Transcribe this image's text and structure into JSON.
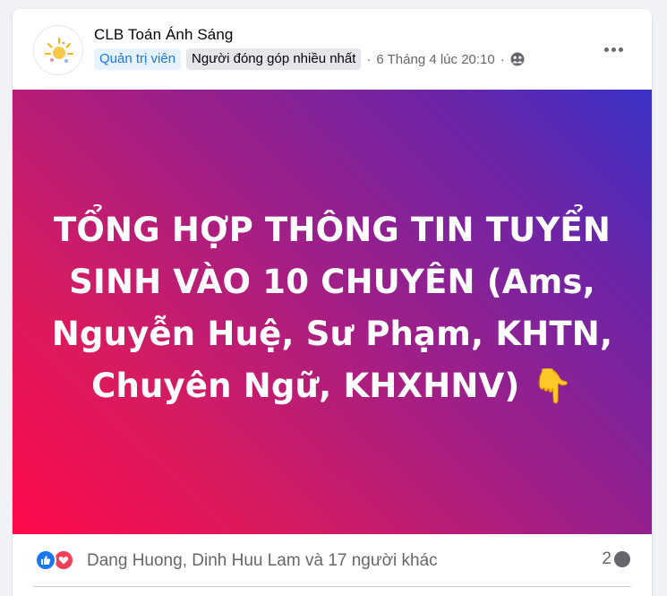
{
  "post": {
    "group_name": "CLB Toán Ánh Sáng",
    "badge_admin": "Quản trị viên",
    "badge_contributor": "Người đóng góp nhiều nhất",
    "separator": "·",
    "timestamp": "6 Tháng 4 lúc 20:10",
    "privacy_icon": "group-globe-icon",
    "more_icon": "more-horizontal-icon"
  },
  "banner": {
    "line1": "TỔNG HỢP THÔNG TIN TUYỂN",
    "line2": "SINH VÀO 10 CHUYÊN (Ams,",
    "line3": "Nguyễn Huệ, Sư Phạm, KHTN,",
    "line4": "Chuyên Ngữ, KHXHNV) 👇",
    "gradient_start": "#ff0a4a",
    "gradient_end": "#3a32c8"
  },
  "reactions": {
    "icons": [
      "like-icon",
      "love-icon"
    ],
    "names": "Dang Huong, Dinh Huu Lam và 17 người khác",
    "comment_count": "2",
    "like_color": "#1877f2",
    "love_color": "#f33e58"
  }
}
